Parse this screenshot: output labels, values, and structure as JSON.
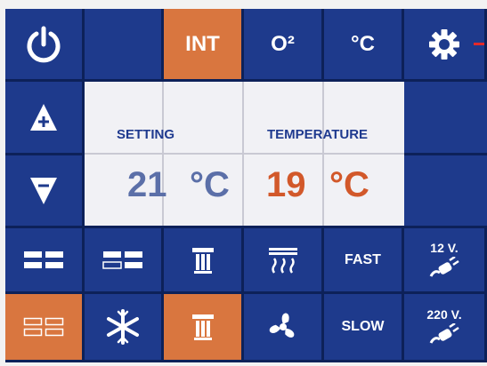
{
  "top_row": {
    "int_label": "INT",
    "o2_label": "O²",
    "celsius_label": "°C"
  },
  "display": {
    "setting_label": "SETTING",
    "temperature_label": "TEMPERATURE",
    "setting_value": "21",
    "setting_unit": "°C",
    "temperature_value": "19",
    "temperature_unit": "°C"
  },
  "controls": {
    "fast_label": "FAST",
    "slow_label": "SLOW",
    "voltage_12": "12 V.",
    "voltage_220": "220 V."
  },
  "colors": {
    "panel_blue": "#1e3a8c",
    "active_orange": "#d9763f",
    "setting_value_color": "#5b6fa8",
    "temperature_value_color": "#d2582a"
  }
}
